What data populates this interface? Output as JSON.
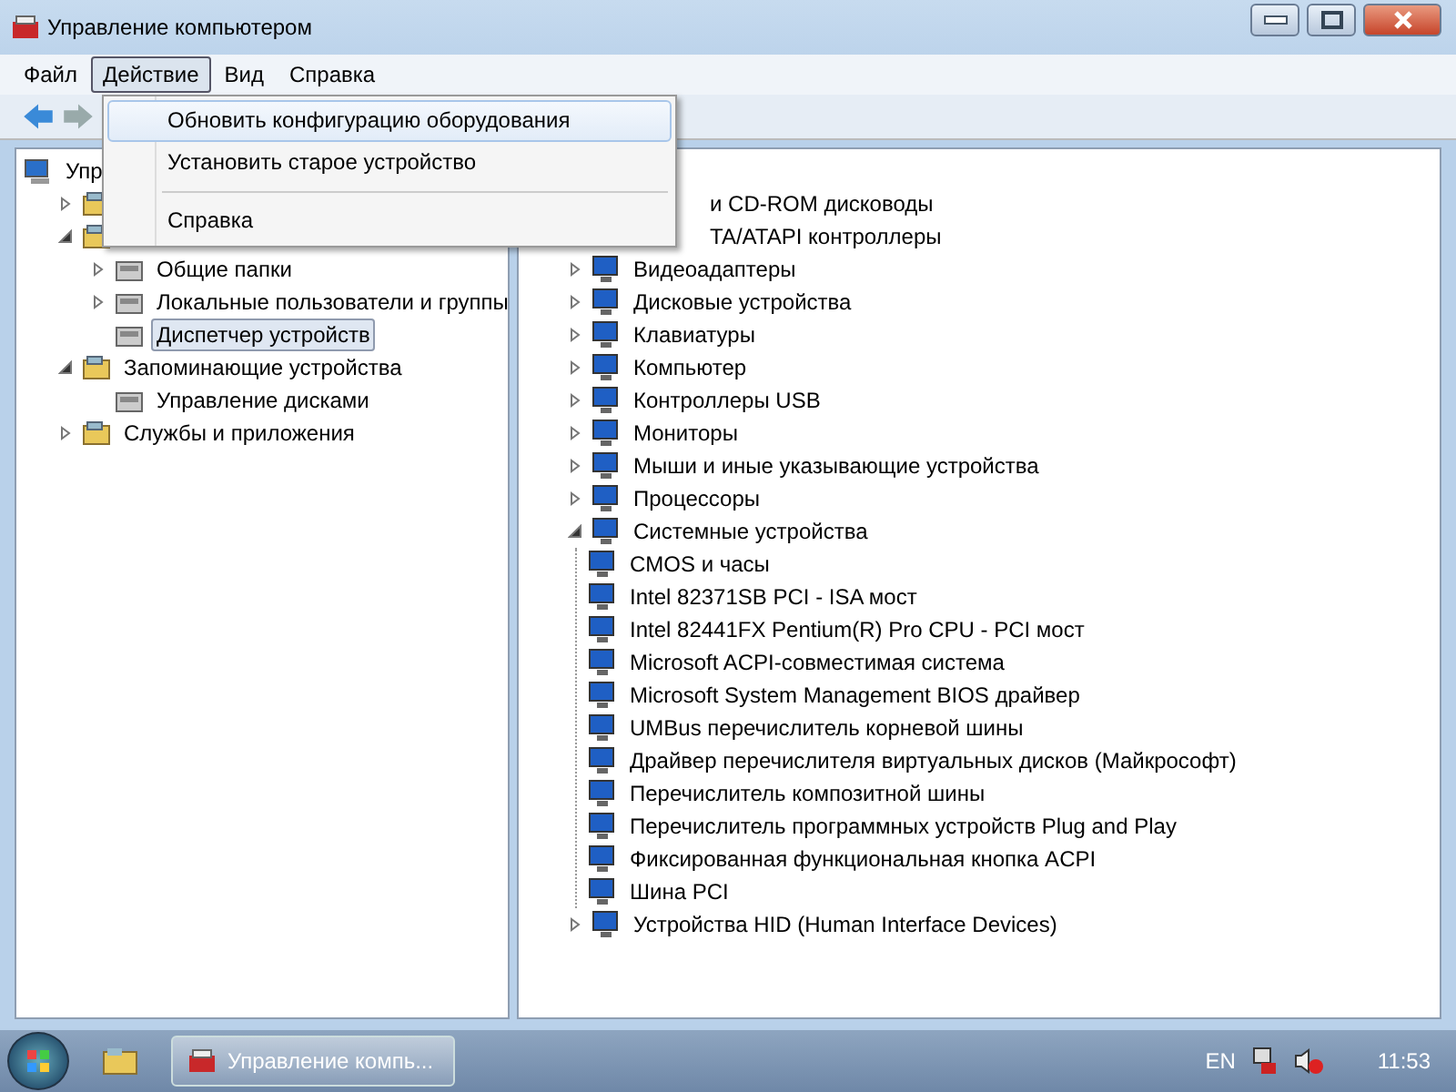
{
  "window": {
    "title": "Управление компьютером"
  },
  "menu_bar": [
    {
      "label": "Файл",
      "selected": false
    },
    {
      "label": "Действие",
      "selected": true
    },
    {
      "label": "Вид",
      "selected": false
    },
    {
      "label": "Справка",
      "selected": false
    }
  ],
  "dropdown": [
    {
      "kind": "item",
      "label": "Обновить конфигурацию оборудования",
      "selected": true
    },
    {
      "kind": "item",
      "label": "Установить старое устройство",
      "selected": false
    },
    {
      "kind": "separator"
    },
    {
      "kind": "item",
      "label": "Справка",
      "selected": false
    }
  ],
  "left_tree": [
    {
      "label": "Упр",
      "selected": false,
      "children": [
        {
          "expanded": false
        },
        {
          "expanded": true,
          "children": [
            {
              "label": "Общие папки",
              "expanded": false,
              "selected": false
            },
            {
              "label": "Локальные пользователи и группы",
              "expanded": false,
              "selected": false
            },
            {
              "label": "Диспетчер устройств",
              "selected": true
            }
          ]
        },
        {
          "label": "Запоминающие устройства",
          "expanded": true,
          "selected": false,
          "children": [
            {
              "label": "Управление дисками",
              "selected": false
            }
          ]
        },
        {
          "label": "Службы и приложения",
          "expanded": false,
          "selected": false
        }
      ]
    }
  ],
  "device_tree": [
    {
      "kind": "covered",
      "label": "и CD-ROM дисководы"
    },
    {
      "kind": "covered",
      "label": "TA/ATAPI контроллеры"
    },
    {
      "kind": "row",
      "label": "Видеоадаптеры",
      "expanded": false
    },
    {
      "kind": "row",
      "label": "Дисковые устройства",
      "expanded": false
    },
    {
      "kind": "row",
      "label": "Клавиатуры",
      "expanded": false
    },
    {
      "kind": "row",
      "label": "Компьютер",
      "expanded": false
    },
    {
      "kind": "row",
      "label": "Контроллеры USB",
      "expanded": false
    },
    {
      "kind": "row",
      "label": "Мониторы",
      "expanded": false
    },
    {
      "kind": "row",
      "label": "Мыши и иные указывающие устройства",
      "expanded": false
    },
    {
      "kind": "row",
      "label": "Процессоры",
      "expanded": false
    },
    {
      "kind": "row",
      "label": "Системные устройства",
      "expanded": true,
      "children": [
        {
          "label": "CMOS и часы"
        },
        {
          "label": "Intel 82371SB PCI - ISA мост"
        },
        {
          "label": "Intel 82441FX Pentium(R) Pro CPU - PCI мост"
        },
        {
          "label": "Microsoft ACPI-совместимая система"
        },
        {
          "label": "Microsoft System Management BIOS драйвер"
        },
        {
          "label": "UMBus перечислитель корневой шины"
        },
        {
          "label": "Драйвер перечислителя виртуальных дисков (Майкрософт)"
        },
        {
          "label": "Перечислитель композитной шины"
        },
        {
          "label": "Перечислитель программных устройств Plug and Play"
        },
        {
          "label": "Фиксированная функциональная кнопка ACPI"
        },
        {
          "label": "Шина PCI"
        }
      ]
    },
    {
      "kind": "row",
      "label": "Устройства HID (Human Interface Devices)",
      "expanded": false
    }
  ],
  "taskbar": {
    "task_button": "Управление компь...",
    "language": "EN",
    "clock": "11:53"
  }
}
